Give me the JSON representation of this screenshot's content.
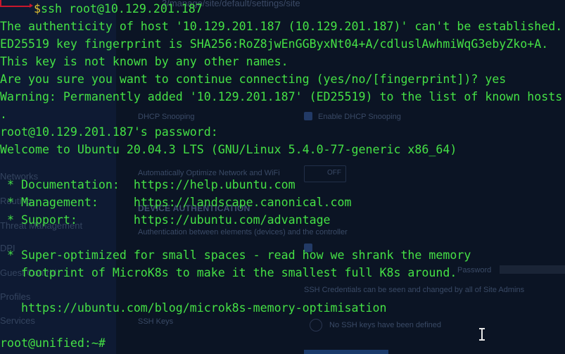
{
  "background_ui": {
    "url_fragment": "3/manage/site/default/settings/site",
    "sidebar_items": [
      "Networks",
      "Routing",
      "Threat Management",
      "DPI",
      "Guest Control",
      "Profiles",
      "Services"
    ],
    "labels": {
      "dhcp_snooping": "DHCP Snooping",
      "enable_dhcp_snooping": "Enable DHCP Snooping",
      "auto_optimize": "Automatically Optimize Network and WiFi",
      "toggle_off": "OFF",
      "device_auth_heading": "DEVICE AUTHENTICATION",
      "device_auth_desc": "Authentication between elements (devices) and the controller",
      "password": "Password",
      "ssh_cred_note": "SSH Credentials can be seen and changed by all of Site Admins",
      "ssh_keys": "SSH Keys",
      "no_ssh_keys": "No SSH keys have been defined"
    }
  },
  "terminal": {
    "command_prompt": "$ssh root@10.129.201.187",
    "lines": [
      "The authenticity of host '10.129.201.187 (10.129.201.187)' can't be established.",
      "ED25519 key fingerprint is SHA256:RoZ8jwEnGGByxNt04+A/cdluslAwhmiWqG3ebyZko+A.",
      "This key is not known by any other names.",
      "Are you sure you want to continue connecting (yes/no/[fingerprint])? yes",
      "Warning: Permanently added '10.129.201.187' (ED25519) to the list of known hosts",
      ".",
      "root@10.129.201.187's password:",
      "Welcome to Ubuntu 20.04.3 LTS (GNU/Linux 5.4.0-77-generic x86_64)",
      "",
      " * Documentation:  https://help.ubuntu.com",
      " * Management:     https://landscape.canonical.com",
      " * Support:        https://ubuntu.com/advantage",
      "",
      " * Super-optimized for small spaces - read how we shrank the memory",
      "   footprint of MicroK8s to make it the smallest full K8s around.",
      "",
      "   https://ubuntu.com/blog/microk8s-memory-optimisation",
      "",
      "root@unified:~#"
    ]
  },
  "colors": {
    "terminal_text": "#45e145",
    "prompt_accent": "#c9172c",
    "dollar": "#e0c030",
    "background": "#000000"
  }
}
